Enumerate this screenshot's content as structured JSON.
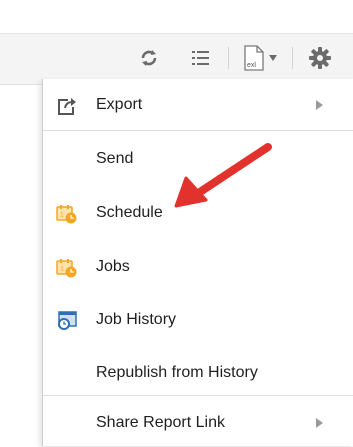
{
  "toolbar": {
    "buttons": [
      {
        "name": "refresh-icon"
      },
      {
        "name": "list-icon"
      },
      {
        "name": "export-file-icon",
        "badge": "exl"
      },
      {
        "name": "gear-icon"
      }
    ]
  },
  "menu": {
    "items": [
      {
        "label": "Export",
        "icon": "export-icon",
        "submenu": true
      },
      {
        "label": "Send",
        "icon": "",
        "submenu": false
      },
      {
        "label": "Schedule",
        "icon": "calendar-clock-icon",
        "submenu": false
      },
      {
        "label": "Jobs",
        "icon": "calendar-clock-icon",
        "submenu": false
      },
      {
        "label": "Job History",
        "icon": "job-history-icon",
        "submenu": false
      },
      {
        "label": "Republish from History",
        "icon": "",
        "submenu": false
      },
      {
        "label": "Share Report Link",
        "icon": "",
        "submenu": true
      }
    ]
  },
  "colors": {
    "arrow": "#e2322d",
    "calendar": "#f5a623",
    "history_icon": "#2f6fb3"
  }
}
